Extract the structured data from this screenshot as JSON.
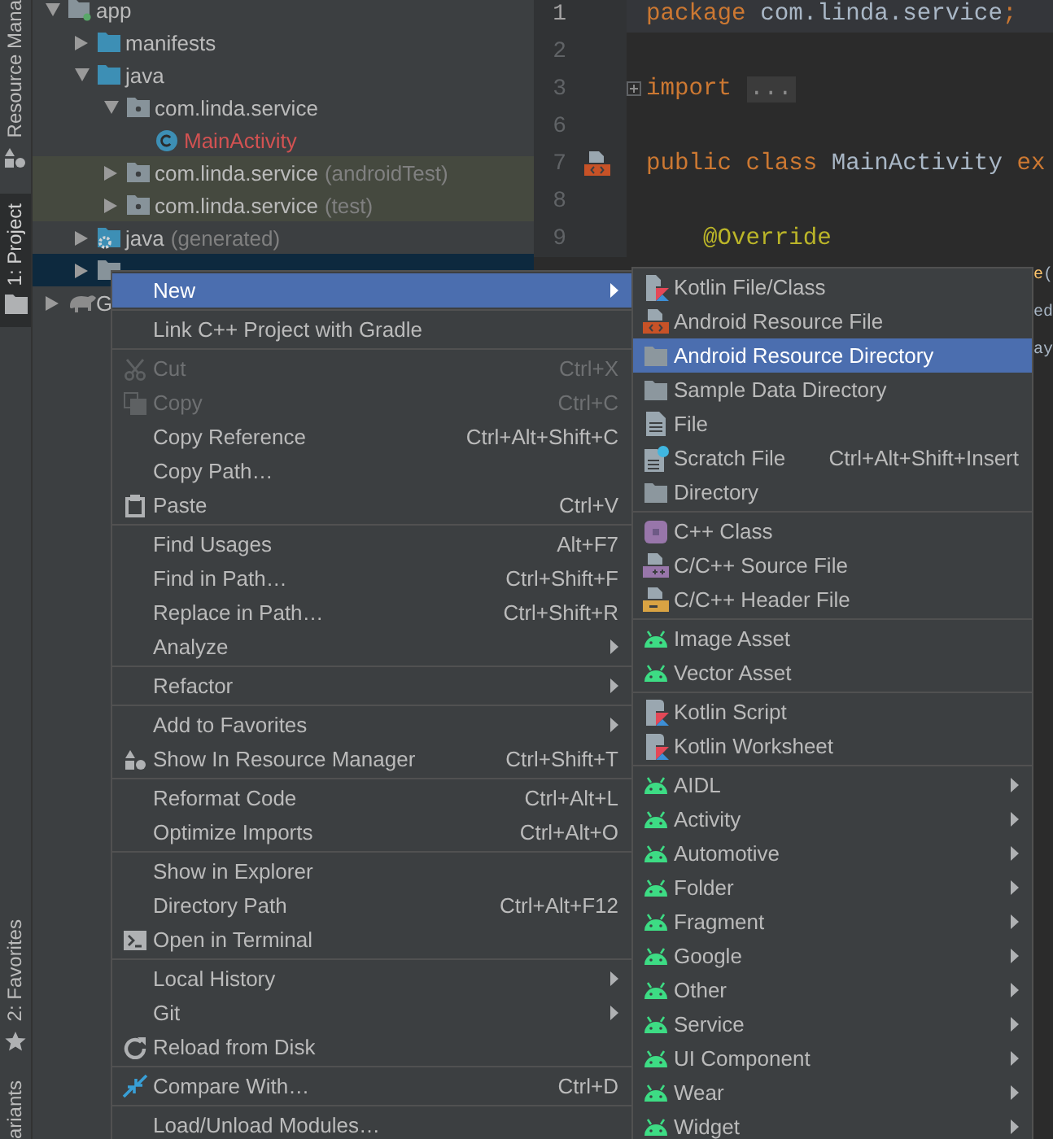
{
  "tool_strip": {
    "top": [
      {
        "label": "Resource Mana",
        "selected": false
      },
      {
        "label": "1: Project",
        "selected": true
      }
    ],
    "bottom": [
      {
        "label": "2: Favorites",
        "selected": false
      },
      {
        "label": "ariants",
        "selected": false
      }
    ]
  },
  "project_tree": [
    {
      "label": "app",
      "kind": "module",
      "expanded": true,
      "selected": false,
      "children": [
        {
          "label": "manifests",
          "kind": "source-folder",
          "expanded": false,
          "selected": false
        },
        {
          "label": "java",
          "kind": "source-folder",
          "expanded": true,
          "selected": false,
          "children": [
            {
              "label": "com.linda.service",
              "kind": "package",
              "expanded": true,
              "selected": false,
              "children": [
                {
                  "label": "MainActivity",
                  "kind": "class",
                  "selected": false
                }
              ]
            },
            {
              "label": "com.linda.service",
              "note": "(androidTest)",
              "kind": "test-package",
              "expanded": false,
              "selected": false
            },
            {
              "label": "com.linda.service",
              "note": "(test)",
              "kind": "test-package",
              "expanded": false,
              "selected": false
            }
          ]
        },
        {
          "label": "java",
          "note": "(generated)",
          "kind": "generated-folder",
          "expanded": false,
          "selected": false
        },
        {
          "kind": "resource-folder",
          "expanded": false,
          "selected": true
        }
      ]
    },
    {
      "label": "G",
      "kind": "gradle",
      "expanded": false,
      "selected": false
    }
  ],
  "editor": {
    "lines": [
      {
        "number": "1",
        "kind": "plain",
        "current": true,
        "tokens": [
          {
            "text": "package",
            "kind": "keyword"
          },
          {
            "text": " com.linda.service",
            "kind": "plain"
          },
          {
            "text": ";",
            "kind": "keyword"
          }
        ]
      },
      {
        "number": "2",
        "kind": "plain",
        "current": false
      },
      {
        "number": "3",
        "kind": "fold",
        "current": false,
        "tokens": [
          {
            "text": "import",
            "kind": "keyword"
          },
          {
            "text": "...",
            "kind": "folded"
          }
        ]
      },
      {
        "number": "6",
        "kind": "plain",
        "current": false
      },
      {
        "number": "7",
        "kind": "resource-link",
        "current": false,
        "tokens": [
          {
            "text": "public class ",
            "kind": "keyword"
          },
          {
            "text": "MainActivity ",
            "kind": "plain"
          },
          {
            "text": "ex",
            "kind": "keyword"
          }
        ]
      },
      {
        "number": "8",
        "kind": "plain",
        "current": false
      },
      {
        "number": "9",
        "kind": "plain",
        "current": false,
        "tokens": [
          {
            "text": "    @Override",
            "kind": "annotation"
          }
        ]
      },
      {
        "kind": "covered",
        "tokens": [
          {
            "text": "e",
            "kind": "method"
          },
          {
            "text": "(",
            "kind": "plain"
          }
        ]
      },
      {
        "kind": "covered",
        "tokens": [
          {
            "text": "ed",
            "kind": "plain"
          }
        ]
      },
      {
        "kind": "covered",
        "tokens": [
          {
            "text": "ay",
            "kind": "plain"
          }
        ]
      }
    ]
  },
  "context_menu": {
    "groups": [
      [
        {
          "label": "New",
          "submenu": true,
          "disabled": false,
          "selected": true
        }
      ],
      [
        {
          "label": "Link C++ Project with Gradle",
          "submenu": false,
          "disabled": false,
          "selected": false
        }
      ],
      [
        {
          "label": "Cut",
          "shortcut": "Ctrl+X",
          "submenu": false,
          "disabled": true,
          "selected": false
        },
        {
          "label": "Copy",
          "shortcut": "Ctrl+C",
          "submenu": false,
          "disabled": true,
          "selected": false
        },
        {
          "label": "Copy Reference",
          "shortcut": "Ctrl+Alt+Shift+C",
          "submenu": false,
          "disabled": false,
          "selected": false
        },
        {
          "label": "Copy Path…",
          "submenu": false,
          "disabled": false,
          "selected": false
        },
        {
          "label": "Paste",
          "shortcut": "Ctrl+V",
          "submenu": false,
          "disabled": false,
          "selected": false
        }
      ],
      [
        {
          "label": "Find Usages",
          "shortcut": "Alt+F7",
          "submenu": false,
          "disabled": false,
          "selected": false
        },
        {
          "label": "Find in Path…",
          "shortcut": "Ctrl+Shift+F",
          "submenu": false,
          "disabled": false,
          "selected": false
        },
        {
          "label": "Replace in Path…",
          "shortcut": "Ctrl+Shift+R",
          "submenu": false,
          "disabled": false,
          "selected": false
        },
        {
          "label": "Analyze",
          "submenu": true,
          "disabled": false,
          "selected": false
        }
      ],
      [
        {
          "label": "Refactor",
          "submenu": true,
          "disabled": false,
          "selected": false
        }
      ],
      [
        {
          "label": "Add to Favorites",
          "submenu": true,
          "disabled": false,
          "selected": false
        },
        {
          "label": "Show In Resource Manager",
          "shortcut": "Ctrl+Shift+T",
          "submenu": false,
          "disabled": false,
          "selected": false
        }
      ],
      [
        {
          "label": "Reformat Code",
          "shortcut": "Ctrl+Alt+L",
          "submenu": false,
          "disabled": false,
          "selected": false
        },
        {
          "label": "Optimize Imports",
          "shortcut": "Ctrl+Alt+O",
          "submenu": false,
          "disabled": false,
          "selected": false
        }
      ],
      [
        {
          "label": "Show in Explorer",
          "submenu": false,
          "disabled": false,
          "selected": false
        },
        {
          "label": "Directory Path",
          "shortcut": "Ctrl+Alt+F12",
          "submenu": false,
          "disabled": false,
          "selected": false
        },
        {
          "label": "Open in Terminal",
          "submenu": false,
          "disabled": false,
          "selected": false
        }
      ],
      [
        {
          "label": "Local History",
          "submenu": true,
          "disabled": false,
          "selected": false
        },
        {
          "label": "Git",
          "submenu": true,
          "disabled": false,
          "selected": false
        },
        {
          "label": "Reload from Disk",
          "submenu": false,
          "disabled": false,
          "selected": false
        }
      ],
      [
        {
          "label": "Compare With…",
          "shortcut": "Ctrl+D",
          "submenu": false,
          "disabled": false,
          "selected": false
        }
      ],
      [
        {
          "label": "Load/Unload Modules…",
          "submenu": false,
          "disabled": false,
          "selected": false
        }
      ]
    ]
  },
  "new_submenu": {
    "groups": [
      [
        {
          "label": "Kotlin File/Class",
          "submenu": false,
          "disabled": false,
          "selected": false
        },
        {
          "label": "Android Resource File",
          "submenu": false,
          "disabled": false,
          "selected": false
        },
        {
          "label": "Android Resource Directory",
          "submenu": false,
          "disabled": false,
          "selected": true
        },
        {
          "label": "Sample Data Directory",
          "submenu": false,
          "disabled": false,
          "selected": false
        },
        {
          "label": "File",
          "submenu": false,
          "disabled": false,
          "selected": false
        },
        {
          "label": "Scratch File",
          "shortcut": "Ctrl+Alt+Shift+Insert",
          "submenu": false,
          "disabled": false,
          "selected": false
        },
        {
          "label": "Directory",
          "submenu": false,
          "disabled": false,
          "selected": false
        }
      ],
      [
        {
          "label": "C++ Class",
          "submenu": false,
          "disabled": false,
          "selected": false
        },
        {
          "label": "C/C++ Source File",
          "submenu": false,
          "disabled": false,
          "selected": false
        },
        {
          "label": "C/C++ Header File",
          "submenu": false,
          "disabled": false,
          "selected": false
        }
      ],
      [
        {
          "label": "Image Asset",
          "submenu": false,
          "disabled": false,
          "selected": false
        },
        {
          "label": "Vector Asset",
          "submenu": false,
          "disabled": false,
          "selected": false
        }
      ],
      [
        {
          "label": "Kotlin Script",
          "submenu": false,
          "disabled": false,
          "selected": false
        },
        {
          "label": "Kotlin Worksheet",
          "submenu": false,
          "disabled": false,
          "selected": false
        }
      ],
      [
        {
          "label": "AIDL",
          "submenu": true,
          "disabled": false,
          "selected": false
        },
        {
          "label": "Activity",
          "submenu": true,
          "disabled": false,
          "selected": false
        },
        {
          "label": "Automotive",
          "submenu": true,
          "disabled": false,
          "selected": false
        },
        {
          "label": "Folder",
          "submenu": true,
          "disabled": false,
          "selected": false
        },
        {
          "label": "Fragment",
          "submenu": true,
          "disabled": false,
          "selected": false
        },
        {
          "label": "Google",
          "submenu": true,
          "disabled": false,
          "selected": false
        },
        {
          "label": "Other",
          "submenu": true,
          "disabled": false,
          "selected": false
        },
        {
          "label": "Service",
          "submenu": true,
          "disabled": false,
          "selected": false
        },
        {
          "label": "UI Component",
          "submenu": true,
          "disabled": false,
          "selected": false
        },
        {
          "label": "Wear",
          "submenu": true,
          "disabled": false,
          "selected": false
        },
        {
          "label": "Widget",
          "submenu": true,
          "disabled": false,
          "selected": false
        }
      ]
    ]
  }
}
